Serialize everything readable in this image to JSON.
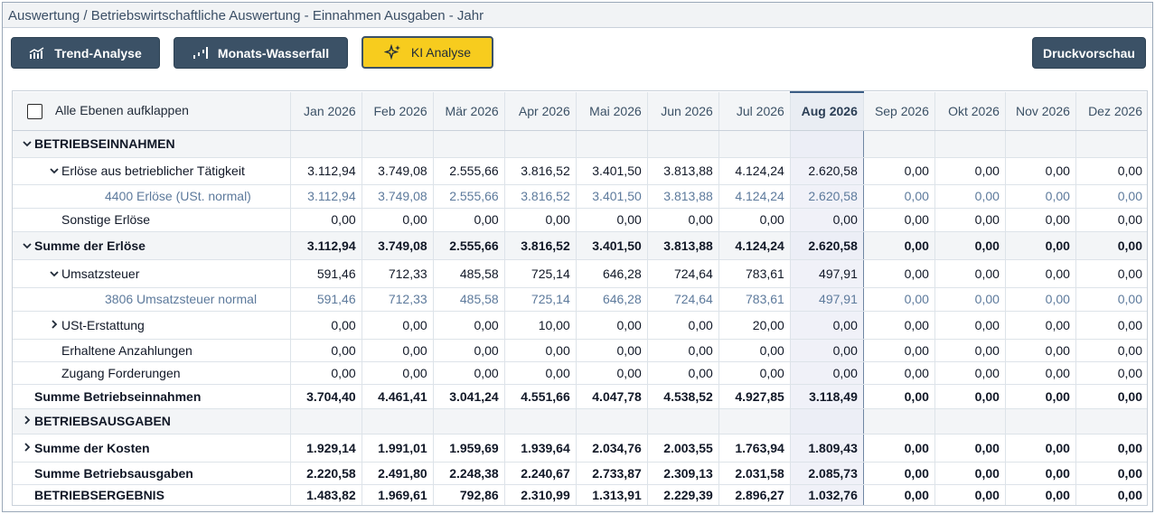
{
  "window": {
    "title": "Auswertung / Betriebswirtschaftliche Auswertung - Einnahmen Ausgaben - Jahr"
  },
  "toolbar": {
    "trend_label": "Trend-Analyse",
    "waterfall_label": "Monats-Wasserfall",
    "ki_label": "KI Analyse",
    "print_label": "Druckvorschau"
  },
  "table": {
    "expand_all_label": "Alle Ebenen aufklappen",
    "selected_month": "Aug 2026",
    "months": [
      "Jan 2026",
      "Feb 2026",
      "Mär 2026",
      "Apr 2026",
      "Mai 2026",
      "Jun 2026",
      "Jul 2026",
      "Aug 2026",
      "Sep 2026",
      "Okt 2026",
      "Nov 2026",
      "Dez 2026"
    ],
    "rows": [
      {
        "label": "BETRIEBSEINNAHMEN",
        "type": "section",
        "chevron": "down",
        "indent": 0,
        "values": []
      },
      {
        "label": "Erlöse aus betrieblicher Tätigkeit",
        "type": "normal",
        "chevron": "down",
        "indent": 1,
        "values": [
          "3.112,94",
          "3.749,08",
          "2.555,66",
          "3.816,52",
          "3.401,50",
          "3.813,88",
          "4.124,24",
          "2.620,58",
          "0,00",
          "0,00",
          "0,00",
          "0,00"
        ]
      },
      {
        "label": "4400 Erlöse (USt. normal)",
        "type": "acct",
        "chevron": "",
        "indent": 2,
        "values": [
          "3.112,94",
          "3.749,08",
          "2.555,66",
          "3.816,52",
          "3.401,50",
          "3.813,88",
          "4.124,24",
          "2.620,58",
          "0,00",
          "0,00",
          "0,00",
          "0,00"
        ]
      },
      {
        "label": "Sonstige Erlöse",
        "type": "normal",
        "chevron": "",
        "indent": 1,
        "values": [
          "0,00",
          "0,00",
          "0,00",
          "0,00",
          "0,00",
          "0,00",
          "0,00",
          "0,00",
          "0,00",
          "0,00",
          "0,00",
          "0,00"
        ]
      },
      {
        "label": "Summe der Erlöse",
        "type": "bold-section",
        "chevron": "down",
        "indent": 0,
        "values": [
          "3.112,94",
          "3.749,08",
          "2.555,66",
          "3.816,52",
          "3.401,50",
          "3.813,88",
          "4.124,24",
          "2.620,58",
          "0,00",
          "0,00",
          "0,00",
          "0,00"
        ]
      },
      {
        "label": "Umsatzsteuer",
        "type": "normal",
        "chevron": "down",
        "indent": 1,
        "values": [
          "591,46",
          "712,33",
          "485,58",
          "725,14",
          "646,28",
          "724,64",
          "783,61",
          "497,91",
          "0,00",
          "0,00",
          "0,00",
          "0,00"
        ]
      },
      {
        "label": "3806 Umsatzsteuer normal",
        "type": "acct",
        "chevron": "",
        "indent": 2,
        "values": [
          "591,46",
          "712,33",
          "485,58",
          "725,14",
          "646,28",
          "724,64",
          "783,61",
          "497,91",
          "0,00",
          "0,00",
          "0,00",
          "0,00"
        ]
      },
      {
        "label": "USt-Erstattung",
        "type": "normal",
        "chevron": "right",
        "indent": 1,
        "values": [
          "0,00",
          "0,00",
          "0,00",
          "10,00",
          "0,00",
          "0,00",
          "20,00",
          "0,00",
          "0,00",
          "0,00",
          "0,00",
          "0,00"
        ]
      },
      {
        "label": "Erhaltene Anzahlungen",
        "type": "normal",
        "chevron": "",
        "indent": 1,
        "values": [
          "0,00",
          "0,00",
          "0,00",
          "0,00",
          "0,00",
          "0,00",
          "0,00",
          "0,00",
          "0,00",
          "0,00",
          "0,00",
          "0,00"
        ]
      },
      {
        "label": "Zugang Forderungen",
        "type": "normal",
        "chevron": "",
        "indent": 1,
        "values": [
          "0,00",
          "0,00",
          "0,00",
          "0,00",
          "0,00",
          "0,00",
          "0,00",
          "0,00",
          "0,00",
          "0,00",
          "0,00",
          "0,00"
        ]
      },
      {
        "label": "Summe Betriebseinnahmen",
        "type": "bold",
        "chevron": "",
        "indent": 0,
        "values": [
          "3.704,40",
          "4.461,41",
          "3.041,24",
          "4.551,66",
          "4.047,78",
          "4.538,52",
          "4.927,85",
          "3.118,49",
          "0,00",
          "0,00",
          "0,00",
          "0,00"
        ]
      },
      {
        "label": "BETRIEBSAUSGABEN",
        "type": "section",
        "chevron": "right",
        "indent": 0,
        "values": []
      },
      {
        "label": "Summe der Kosten",
        "type": "bold",
        "chevron": "right",
        "indent": 0,
        "values": [
          "1.929,14",
          "1.991,01",
          "1.959,69",
          "1.939,64",
          "2.034,76",
          "2.003,55",
          "1.763,94",
          "1.809,43",
          "0,00",
          "0,00",
          "0,00",
          "0,00"
        ]
      },
      {
        "label": "Summe Betriebsausgaben",
        "type": "bold",
        "chevron": "",
        "indent": 0,
        "values": [
          "2.220,58",
          "2.491,80",
          "2.248,38",
          "2.240,67",
          "2.733,87",
          "2.309,13",
          "2.031,58",
          "2.085,73",
          "0,00",
          "0,00",
          "0,00",
          "0,00"
        ]
      },
      {
        "label": "BETRIEBSERGEBNIS",
        "type": "bold",
        "chevron": "",
        "indent": 0,
        "values": [
          "1.483,82",
          "1.969,61",
          "792,86",
          "2.310,99",
          "1.313,91",
          "2.229,39",
          "2.896,27",
          "1.032,76",
          "0,00",
          "0,00",
          "0,00",
          "0,00"
        ]
      }
    ]
  },
  "colors": {
    "primary": "#3b5166",
    "accent": "#f7cc1e",
    "account_text": "#5d7a9c",
    "selected_column": "#f0f1f8"
  }
}
